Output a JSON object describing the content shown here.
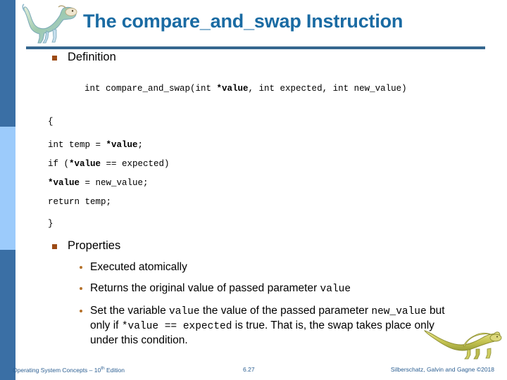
{
  "slide": {
    "title": "The compare_and_swap  Instruction",
    "title_color": "#1a6ba3",
    "rule_color": "#35678f",
    "accent_bullet_color": "#9c4a14",
    "stripe_dark_color": "#3a6fa5",
    "stripe_light_color": "#9ccbfb"
  },
  "sections": {
    "definition": {
      "heading": "Definition",
      "code": {
        "signature_plain_1": "int compare_and_swap(int ",
        "signature_bold_1": "*value",
        "signature_plain_2": ", int expected, int new_value)",
        "open_brace": "{",
        "line_1_plain": "int temp = ",
        "line_1_bold": "*value",
        "line_1_tail": ";",
        "line_2_plain_1": "if (",
        "line_2_bold": "*value",
        "line_2_plain_2": " == expected)",
        "line_3_bold": "*value",
        "line_3_plain": " = new_value;",
        "line_4": "return temp;",
        "close_brace": "}"
      }
    },
    "properties": {
      "heading": "Properties",
      "items": [
        {
          "parts": [
            {
              "text": "Executed atomically",
              "mono": false
            }
          ]
        },
        {
          "parts": [
            {
              "text": "Returns the original value of passed parameter ",
              "mono": false
            },
            {
              "text": "value",
              "mono": true
            }
          ]
        },
        {
          "parts": [
            {
              "text": "Set  the variable ",
              "mono": false
            },
            {
              "text": "value",
              "mono": true
            },
            {
              "text": " the value of the passed parameter ",
              "mono": false
            },
            {
              "text": "new_value",
              "mono": true
            },
            {
              "text": " but only if ",
              "mono": false
            },
            {
              "text": "*value == expected",
              "mono": true
            },
            {
              "text": " is true. That is, the swap takes place only under this condition.",
              "mono": false
            }
          ]
        }
      ]
    }
  },
  "footer": {
    "left_before_sup": "Operating System Concepts – 10",
    "left_sup": "th",
    "left_after_sup": " Edition",
    "page_number": "6.27",
    "right": "Silberschatz, Galvin and Gagne ©2018",
    "color": "#2c5f92"
  },
  "icons": {
    "header_logo": "dinosaur-logo",
    "footer_logo": "dinosaur-footer"
  }
}
